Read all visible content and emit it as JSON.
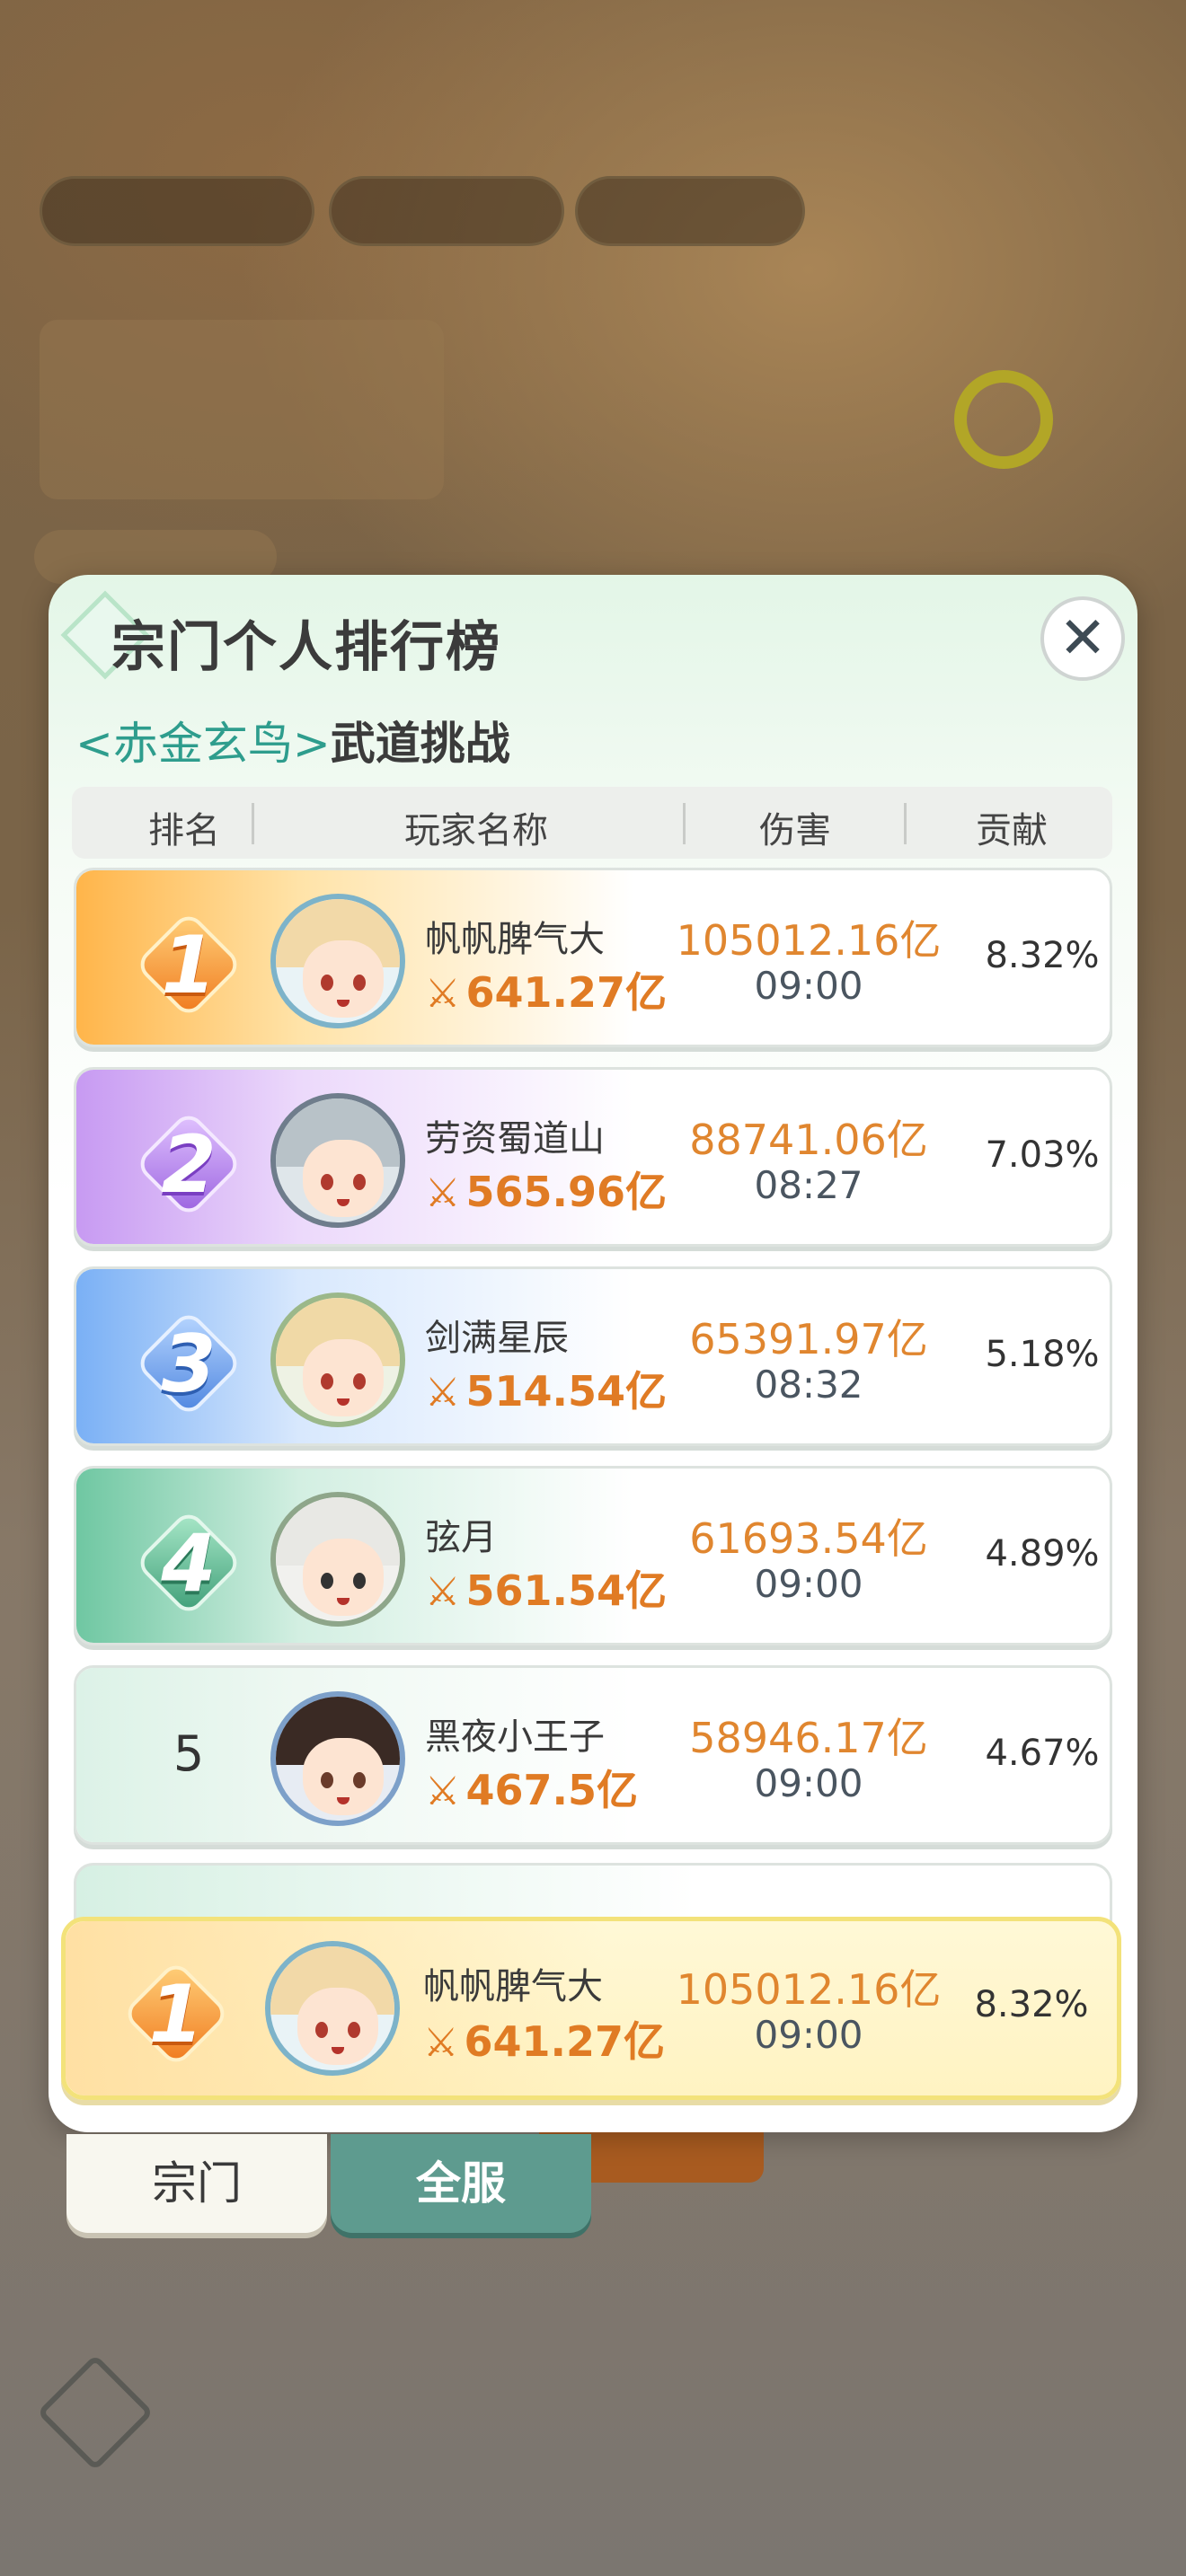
{
  "panel": {
    "title": "宗门个人排行榜",
    "subtitle_boss": "<赤金玄鸟>",
    "subtitle_mode": "武道挑战",
    "close_label": "✕"
  },
  "table": {
    "headers": [
      "排名",
      "玩家名称",
      "伤害",
      "贡献"
    ],
    "rows": [
      {
        "rank": "1",
        "name": "帆帆脾气大",
        "power": "641.27亿",
        "damage": "105012.16亿",
        "time": "09:00",
        "contribution": "8.32%"
      },
      {
        "rank": "2",
        "name": "劳资蜀道山",
        "power": "565.96亿",
        "damage": "88741.06亿",
        "time": "08:27",
        "contribution": "7.03%"
      },
      {
        "rank": "3",
        "name": "剑满星辰",
        "power": "514.54亿",
        "damage": "65391.97亿",
        "time": "08:32",
        "contribution": "5.18%"
      },
      {
        "rank": "4",
        "name": "弦月",
        "power": "561.54亿",
        "damage": "61693.54亿",
        "time": "09:00",
        "contribution": "4.89%"
      },
      {
        "rank": "5",
        "name": "黑夜小王子",
        "power": "467.5亿",
        "damage": "58946.17亿",
        "time": "09:00",
        "contribution": "4.67%"
      }
    ]
  },
  "my_rank": {
    "rank": "1",
    "name": "帆帆脾气大",
    "power": "641.27亿",
    "damage": "105012.16亿",
    "time": "09:00",
    "contribution": "8.32%"
  },
  "tabs": [
    {
      "label": "宗门",
      "active": false
    },
    {
      "label": "全服",
      "active": true
    }
  ],
  "colors": {
    "accent_teal": "#2e9d8d",
    "damage_orange": "#e0862f",
    "rank1": "#f59b2c",
    "rank2": "#a77be0",
    "rank3": "#5f97e6",
    "rank4": "#4fae8a"
  },
  "icons": {
    "power": "crossed-swords-icon",
    "close": "close-icon"
  }
}
